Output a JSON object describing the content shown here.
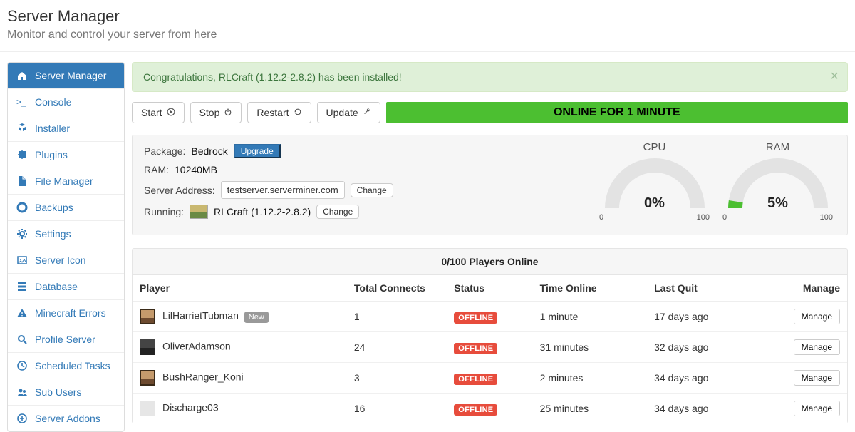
{
  "header": {
    "title": "Server Manager",
    "subtitle": "Monitor and control your server from here"
  },
  "sidebar": {
    "items": [
      {
        "label": "Server Manager",
        "icon": "home",
        "active": true
      },
      {
        "label": "Console",
        "icon": "terminal",
        "active": false
      },
      {
        "label": "Installer",
        "icon": "cubes",
        "active": false
      },
      {
        "label": "Plugins",
        "icon": "puzzle",
        "active": false
      },
      {
        "label": "File Manager",
        "icon": "file",
        "active": false
      },
      {
        "label": "Backups",
        "icon": "lifebuoy",
        "active": false
      },
      {
        "label": "Settings",
        "icon": "gear",
        "active": false
      },
      {
        "label": "Server Icon",
        "icon": "image",
        "active": false
      },
      {
        "label": "Database",
        "icon": "server",
        "active": false
      },
      {
        "label": "Minecraft Errors",
        "icon": "warning",
        "active": false
      },
      {
        "label": "Profile Server",
        "icon": "search",
        "active": false
      },
      {
        "label": "Scheduled Tasks",
        "icon": "clock",
        "active": false
      },
      {
        "label": "Sub Users",
        "icon": "users",
        "active": false
      },
      {
        "label": "Server Addons",
        "icon": "plus",
        "active": false
      }
    ]
  },
  "alert": {
    "text": "Congratulations, RLCraft (1.12.2-2.8.2) has been installed!"
  },
  "controls": {
    "start": "Start",
    "stop": "Stop",
    "restart": "Restart",
    "update": "Update"
  },
  "status_bar": "ONLINE FOR 1 MINUTE",
  "info": {
    "package_label": "Package:",
    "package_value": "Bedrock",
    "upgrade_label": "Upgrade",
    "ram_label": "RAM:",
    "ram_value": "10240MB",
    "addr_label": "Server Address:",
    "addr_value": "testserver.serverminer.com",
    "change_label": "Change",
    "running_label": "Running:",
    "running_value": "RLCraft (1.12.2-2.8.2)"
  },
  "gauges": {
    "cpu": {
      "title": "CPU",
      "value": "0%",
      "percent": 0,
      "min": "0",
      "max": "100"
    },
    "ram": {
      "title": "RAM",
      "value": "5%",
      "percent": 5,
      "min": "0",
      "max": "100"
    }
  },
  "players": {
    "header": "0/100 Players Online",
    "columns": {
      "player": "Player",
      "connects": "Total Connects",
      "status": "Status",
      "time": "Time Online",
      "last": "Last Quit",
      "manage": "Manage"
    },
    "new_badge": "New",
    "offline_badge": "OFFLINE",
    "manage_label": "Manage",
    "rows": [
      {
        "avatar": "a1",
        "name": "LilHarrietTubman",
        "new": true,
        "connects": "1",
        "status": "OFFLINE",
        "time": "1 minute",
        "last": "17 days ago"
      },
      {
        "avatar": "a2",
        "name": "OliverAdamson",
        "new": false,
        "connects": "24",
        "status": "OFFLINE",
        "time": "31 minutes",
        "last": "32 days ago"
      },
      {
        "avatar": "a1",
        "name": "BushRanger_Koni",
        "new": false,
        "connects": "3",
        "status": "OFFLINE",
        "time": "2 minutes",
        "last": "34 days ago"
      },
      {
        "avatar": "a3",
        "name": "Discharge03",
        "new": false,
        "connects": "16",
        "status": "OFFLINE",
        "time": "25 minutes",
        "last": "34 days ago"
      }
    ]
  }
}
